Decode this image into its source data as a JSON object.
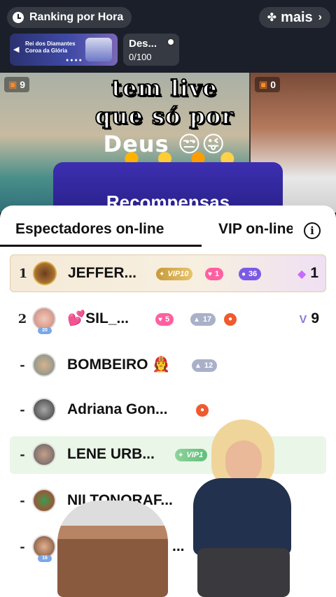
{
  "header": {
    "ranking_label": "Ranking por Hora",
    "more_label": "mais",
    "banner_text": "Rei dos Diamantes Coroa da Glória",
    "goal_title": "Des...",
    "goal_progress": "0/100"
  },
  "video": {
    "left_gift_count": "9",
    "right_gift_count": "0",
    "overlay_line1": "tem live",
    "overlay_line2": "que só por",
    "overlay_line3": "Deus 😒😜",
    "reward_label": "Recompensas"
  },
  "sheet": {
    "tab_online": "Espectadores on-line",
    "tab_vip": "VIP on-line",
    "info_icon": "i",
    "rows": [
      {
        "rank": "1",
        "name": "JEFFER...",
        "vip": "VIP10",
        "heart": "1",
        "purple": "36",
        "right": "1",
        "level": ""
      },
      {
        "rank": "2",
        "name": "💕SIL_...",
        "heart": "5",
        "gray": "17",
        "right": "9",
        "level": "20"
      },
      {
        "rank": "-",
        "name": "BOMBEIRO 👩‍🚒",
        "gray": "12"
      },
      {
        "rank": "-",
        "name": "Adriana Gon..."
      },
      {
        "rank": "-",
        "name": "LENE URB...",
        "vip": "VIP1"
      },
      {
        "rank": "-",
        "name": "NILTONORAF..."
      },
      {
        "rank": "-",
        "name": "...",
        "level": "16"
      }
    ]
  },
  "colors": {
    "sheet_bg": "#ffffff",
    "heart_pill": "#ff5fa0",
    "vip_gold": "#c79a3a",
    "vip_green": "#5fbf7a",
    "reward_card": "#3d2fb1"
  }
}
